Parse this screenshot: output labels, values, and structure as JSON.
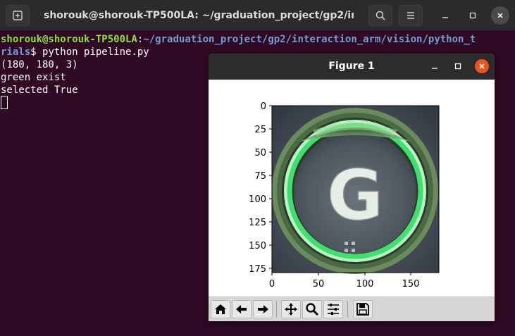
{
  "terminal": {
    "title": "shorouk@shorouk-TP500LA: ~/graduation_project/gp2/inter...",
    "prompt_user": "shorouk@shorouk-TP500LA",
    "prompt_sep": ":",
    "prompt_path_line1": "~/graduation_project/gp2/interaction_arm/vision/python_t",
    "prompt_path_line2": "rials",
    "prompt_symbol": "$ ",
    "command": "python pipeline.py",
    "output": [
      "(180, 180, 3)",
      "green exist",
      "selected True"
    ]
  },
  "figure": {
    "title": "Figure 1",
    "image_letter": "G",
    "x_ticks": [
      "0",
      "50",
      "100",
      "150"
    ],
    "y_ticks": [
      "0",
      "25",
      "50",
      "75",
      "100",
      "125",
      "150",
      "175"
    ],
    "toolbar": [
      "home-icon",
      "back-icon",
      "forward-icon",
      "pan-icon",
      "zoom-icon",
      "configure-subplots-icon",
      "save-icon"
    ]
  },
  "colors": {
    "terminal_bg": "#300a24",
    "prompt_user": "#8ae234",
    "prompt_path": "#729fcf",
    "close_button": "#e95420",
    "button_glow": "#5ff08a"
  }
}
